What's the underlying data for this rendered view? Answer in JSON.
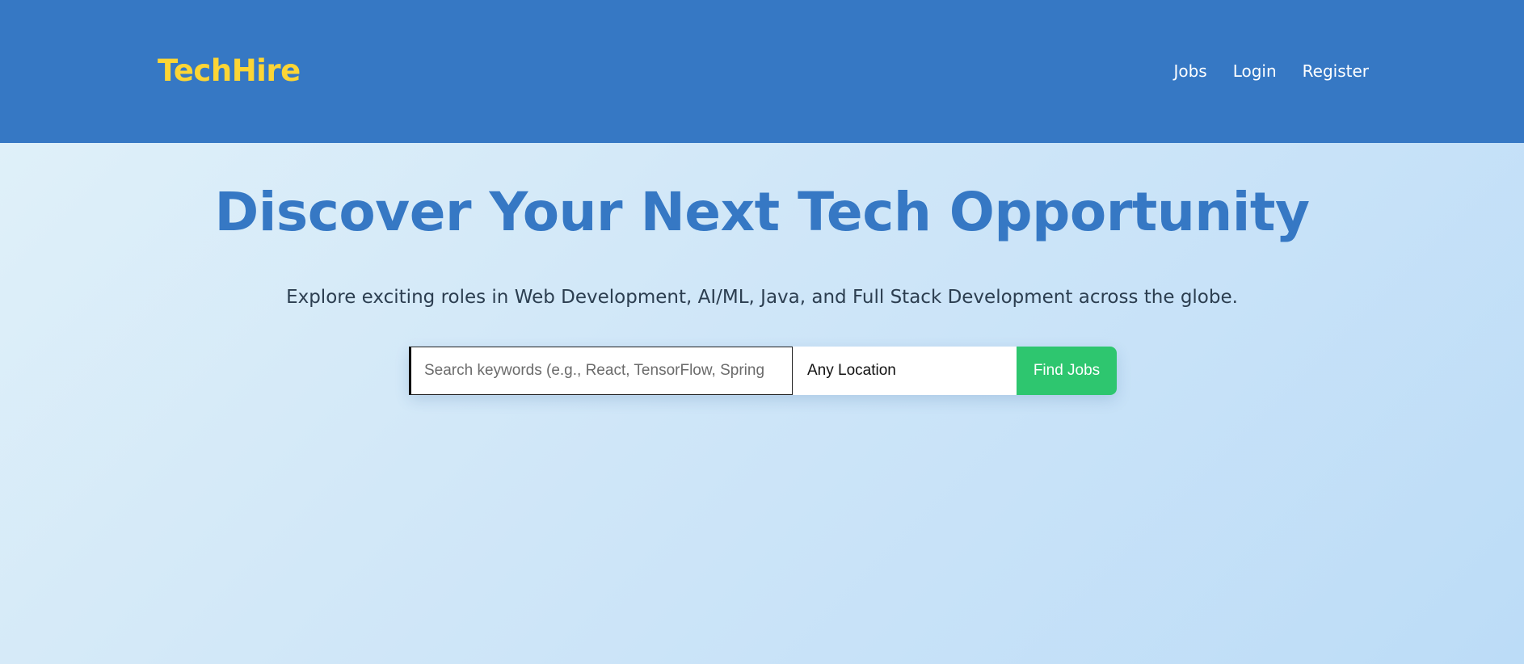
{
  "header": {
    "logo": "TechHire",
    "nav": [
      "Jobs",
      "Login",
      "Register"
    ]
  },
  "hero": {
    "title": "Discover Your Next Tech Opportunity",
    "subtitle": "Explore exciting roles in Web Development, AI/ML, Java, and Full Stack Development across the globe."
  },
  "search": {
    "keyword_placeholder": "Search keywords (e.g., React, TensorFlow, Spring",
    "keyword_value": "",
    "location_value": "Any Location",
    "button_label": "Find Jobs"
  },
  "colors": {
    "header_bg": "#3678c4",
    "logo": "#fcd535",
    "title": "#3678c4",
    "button_bg": "#2ec66f"
  }
}
